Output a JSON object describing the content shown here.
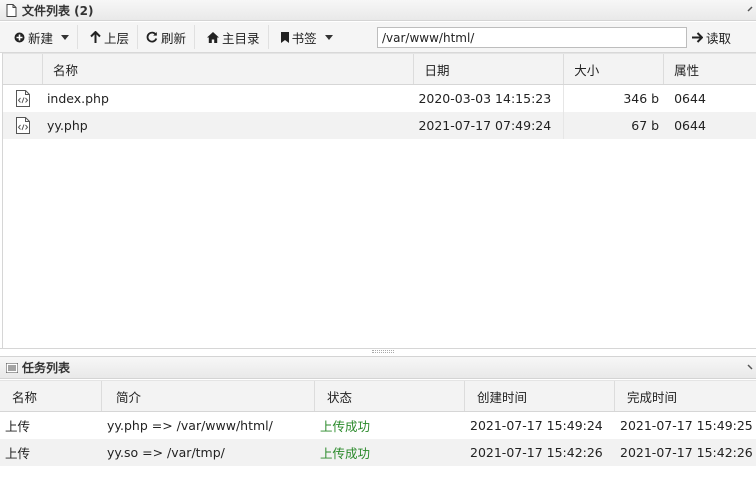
{
  "file_panel": {
    "title": "文件列表 (2)",
    "toolbar": {
      "new_label": "新建",
      "up_label": "上层",
      "refresh_label": "刷新",
      "home_label": "主目录",
      "bookmark_label": "书签",
      "path_value": "/var/www/html/",
      "read_label": "读取"
    },
    "columns": [
      "名称",
      "日期",
      "大小",
      "属性"
    ],
    "rows": [
      {
        "name": "index.php",
        "date": "2020-03-03 14:15:23",
        "size": "346 b",
        "perm": "0644"
      },
      {
        "name": "yy.php",
        "date": "2021-07-17 07:49:24",
        "size": "67 b",
        "perm": "0644"
      }
    ]
  },
  "task_panel": {
    "title": "任务列表",
    "columns": [
      "名称",
      "简介",
      "状态",
      "创建时间",
      "完成时间"
    ],
    "rows": [
      {
        "name": "上传",
        "desc": "yy.php => /var/www/html/",
        "status": "上传成功",
        "created": "2021-07-17 15:49:24",
        "finished": "2021-07-17 15:49:25"
      },
      {
        "name": "上传",
        "desc": "yy.so => /var/tmp/",
        "status": "上传成功",
        "created": "2021-07-17 15:42:26",
        "finished": "2021-07-17 15:42:26"
      }
    ]
  },
  "colors": {
    "status_success": "#2a8a2a"
  },
  "icons": {
    "file_row": "php-file-icon",
    "panel_file": "document-icon",
    "panel_task": "list-icon"
  }
}
